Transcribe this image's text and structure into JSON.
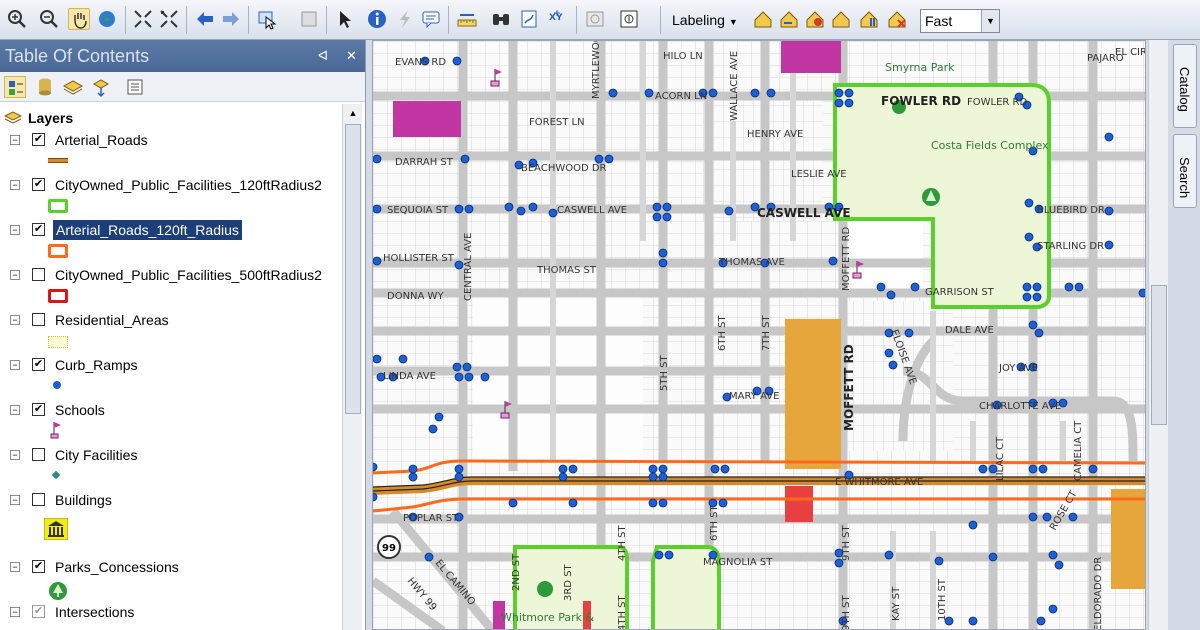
{
  "toolbar": {
    "labeling_label": "Labeling",
    "speed_value": "Fast",
    "buttons": [
      "zoom-in-icon",
      "zoom-out-icon",
      "pan-icon",
      "globe-icon",
      "fixed-zoom-in-icon",
      "fixed-zoom-out-icon",
      "back-icon",
      "forward-icon",
      "select-features-icon",
      "clear-selection-icon",
      "select-elements-icon",
      "identify-icon",
      "hyperlink-icon",
      "html-popup-icon",
      "measure-icon",
      "find-icon",
      "find-route-icon",
      "go-to-xy-icon",
      "time-slider-icon",
      "create-viewer-icon"
    ]
  },
  "toc": {
    "title": "Table Of Contents",
    "root_label": "Layers",
    "layers": [
      {
        "name": "Arterial_Roads",
        "checked": true,
        "expanded": true,
        "symbol": "road-line"
      },
      {
        "name": "CityOwned_Public_Facilities_120ftRadius2",
        "checked": true,
        "expanded": true,
        "symbol": "green-rect"
      },
      {
        "name": "Arterial_Roads_120ft_Radius",
        "checked": true,
        "expanded": true,
        "symbol": "orange-rect",
        "selected": true
      },
      {
        "name": "CityOwned_Public_Facilities_500ftRadius2",
        "checked": false,
        "expanded": true,
        "symbol": "red-rect"
      },
      {
        "name": "Residential_Areas",
        "checked": false,
        "expanded": true,
        "symbol": "yellow-dotted"
      },
      {
        "name": "Curb_Ramps",
        "checked": true,
        "expanded": true,
        "symbol": "blue-dot"
      },
      {
        "name": "Schools",
        "checked": true,
        "expanded": true,
        "symbol": "flag"
      },
      {
        "name": "City Facilities",
        "checked": false,
        "expanded": true,
        "symbol": "diamond"
      },
      {
        "name": "Buildings",
        "checked": false,
        "expanded": true,
        "symbol": "building"
      },
      {
        "name": "Parks_Concessions",
        "checked": true,
        "expanded": true,
        "symbol": "tree"
      },
      {
        "name": "Intersections",
        "checked": true,
        "expanded": true,
        "symbol": "none"
      }
    ]
  },
  "map": {
    "street_labels": [
      "EVANS RD",
      "MYRTLEWOOD DR",
      "HILO LN",
      "ACORN LN",
      "WALLACE AVE",
      "FOREST LN",
      "HENRY AVE",
      "BEACHWOOD DR",
      "LESLIE AVE",
      "DARRAH ST",
      "SEQUOIA ST",
      "CASWELL AVE",
      "CASWELL AVE",
      "HOLLISTER ST",
      "THOMAS ST",
      "THOMAS AVE",
      "DONNA WY",
      "CENTRAL AVE",
      "LINDA AVE",
      "MOFFETT RD",
      "MOFFETT RD",
      "5TH ST",
      "6TH ST",
      "7TH ST",
      "MARY AVE",
      "GARRISON ST",
      "DALE AVE",
      "JOY AVE",
      "CHARLOTTE AVE",
      "BLUEBIRD DR",
      "STARLING DR",
      "FOWLER RD",
      "FOWLER RD",
      "ELOISE AVE",
      "E WHITMORE AVE",
      "POPLAR ST",
      "MAGNOLIA ST",
      "2ND ST",
      "3RD ST",
      "4TH ST",
      "4TH ST",
      "6TH ST",
      "9TH ST",
      "9TH ST",
      "KAY ST",
      "10TH ST",
      "ROSE CT",
      "ELDORADO DR",
      "CAMELIA CT",
      "LILAC CT",
      "EL CAMINO",
      "PAJARO",
      "EL CIRCULO",
      "HWY 99",
      "99"
    ],
    "park_label_1": "Smyrna Park",
    "park_label_2": "Costa Fields Complex",
    "park_label_3": "Whitmore Park &"
  },
  "side_tabs": [
    "Catalog",
    "Search"
  ],
  "colors": {
    "toc_title_bg": "#4a6896",
    "selected_bg": "#1c3f7a",
    "park_outline": "#5ad02b",
    "arterial_buffer": "#ff6a1a",
    "ramp": "#1c5fd6",
    "residential": "#e6a63c",
    "facility": "#c236a4"
  }
}
